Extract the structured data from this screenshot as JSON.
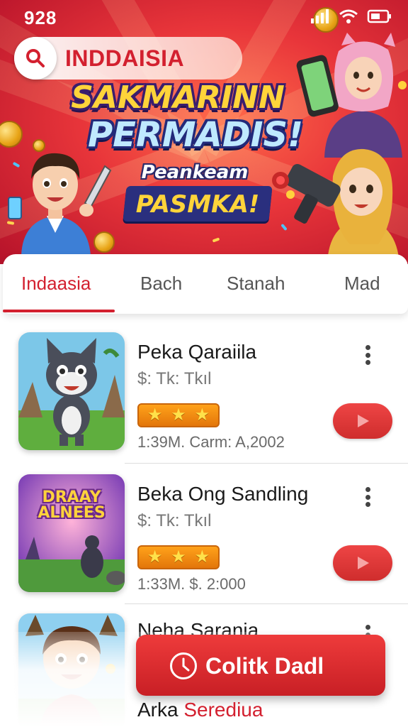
{
  "status": {
    "time": "928"
  },
  "search": {
    "query": "INDDAISIA"
  },
  "banner": {
    "line1": "SAKMARINN",
    "line2": "PERMADIS!",
    "line3": "Peankeam",
    "line4": "PASMKA!"
  },
  "tabs": [
    {
      "label": "Indaasia",
      "active": true
    },
    {
      "label": "Bach",
      "active": false
    },
    {
      "label": "Stanah",
      "active": false
    },
    {
      "label": "Mad",
      "active": false
    }
  ],
  "apps": [
    {
      "title": "Peka Qaraiila",
      "price": "$: Tk: Tkıl",
      "stars": 3,
      "meta": "1:39M. Carm: A,2002"
    },
    {
      "title": "Beka Ong Sandling",
      "price": "$: Tk: Tkıl",
      "stars": 3,
      "meta": "1:33M. $. 2:000",
      "thumb_text": "DRAAY ALNEES"
    },
    {
      "title": "Neha Sarania"
    }
  ],
  "cta": {
    "label": "Colitk Dadl"
  },
  "bottom": {
    "text_part1": "Arka ",
    "text_part2": "Serediua"
  },
  "colors": {
    "accent": "#d3202f",
    "star": "#ffa21a",
    "banner_bg": "#e8353a"
  },
  "icons": [
    "search-icon",
    "signal-icon",
    "wifi-icon",
    "battery-icon",
    "kebab-icon",
    "play-icon",
    "clock-icon",
    "star-icon"
  ]
}
